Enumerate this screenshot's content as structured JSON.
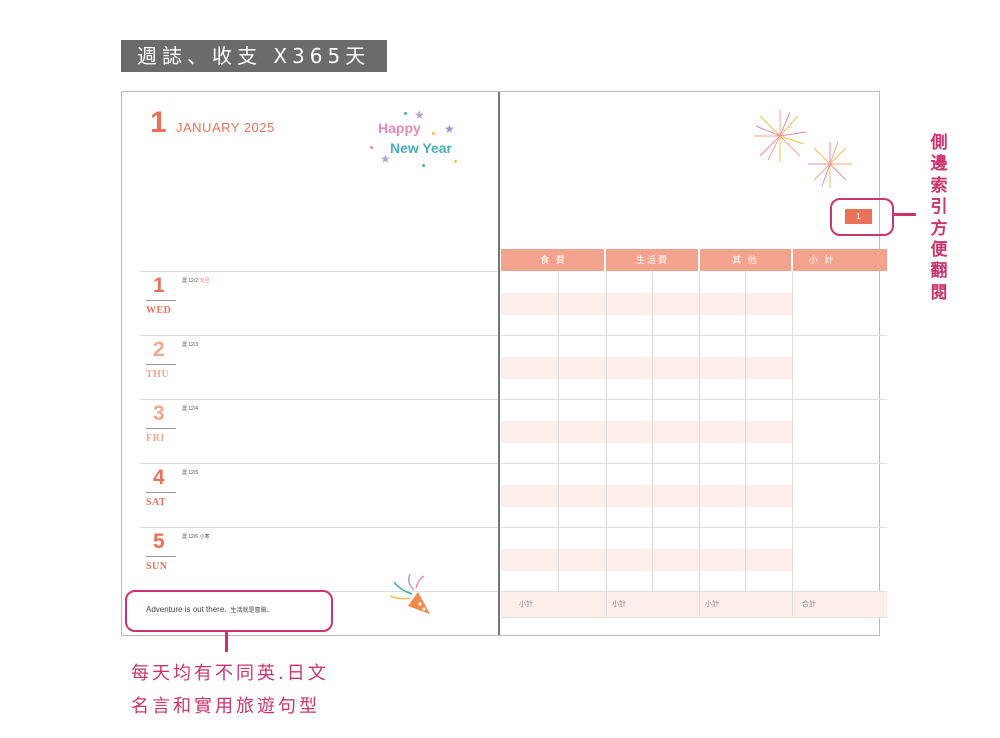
{
  "banner": {
    "title": "週誌、收支 X365天"
  },
  "left_page": {
    "month_number": "1",
    "month_name": "JANUARY 2025",
    "greeting": {
      "line1": "Happy",
      "line2": "New Year"
    },
    "days": [
      {
        "number": "1",
        "weekday": "WED",
        "lunar": "農 12/2",
        "holiday": "元旦",
        "color": "#e8735a"
      },
      {
        "number": "2",
        "weekday": "THU",
        "lunar": "農 12/3",
        "holiday": "",
        "color": "#f0a98f"
      },
      {
        "number": "3",
        "weekday": "FRI",
        "lunar": "農 12/4",
        "holiday": "",
        "color": "#f0a98f"
      },
      {
        "number": "4",
        "weekday": "SAT",
        "lunar": "農 12/5",
        "holiday": "",
        "color": "#e8735a"
      },
      {
        "number": "5",
        "weekday": "SUN",
        "lunar": "農 12/6",
        "holiday": "小寒",
        "color": "#e8735a"
      }
    ],
    "quote": {
      "en": "Adventure is out there.",
      "zh": "生活就是冒險。"
    }
  },
  "right_page": {
    "index_tab": "1",
    "table_headers": [
      "食 費",
      "生活費",
      "其 他",
      "小 計"
    ],
    "subtotal_labels": [
      "小計",
      "小計",
      "小計",
      "合計"
    ]
  },
  "annotations": {
    "side_index": "側邊索引方便翻閱",
    "quote_line1": "每天均有不同英.日文",
    "quote_line2": "名言和實用旅遊句型"
  },
  "colors": {
    "accent": "#e8735a",
    "annotation": "#c9356f",
    "table_header": "#f4a48e",
    "stripe": "#fdeeea"
  }
}
